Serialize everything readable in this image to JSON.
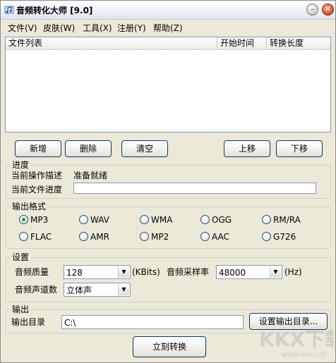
{
  "window": {
    "title": "音频转化大师 [9.0]",
    "minimize_glyph": "–",
    "maximize_glyph": "□",
    "close_glyph": "✕"
  },
  "menu": [
    "文件(V)",
    "皮肤(W)",
    "工具(X)",
    "注册(Y)",
    "帮助(Z)"
  ],
  "file_list": {
    "columns": [
      "文件列表",
      "开始时间",
      "转换长度"
    ],
    "rows": []
  },
  "list_buttons": {
    "add": "新增",
    "delete": "删除",
    "clear": "清空",
    "move_up": "上移",
    "move_down": "下移"
  },
  "progress": {
    "group_title": "进度",
    "operation_label": "当前操作描述",
    "operation_value": "准备就绪",
    "file_progress_label": "当前文件进度",
    "file_progress_value": 0
  },
  "output_format": {
    "group_title": "输出格式",
    "options": [
      "MP3",
      "WAV",
      "WMA",
      "OGG",
      "RM/RA",
      "FLAC",
      "AMR",
      "MP2",
      "AAC",
      "G726"
    ],
    "selected": "MP3"
  },
  "settings": {
    "group_title": "设置",
    "quality_label": "音频质量",
    "quality_value": "128",
    "quality_unit": "(KBits)",
    "sample_rate_label": "音频采样率",
    "sample_rate_value": "48000",
    "sample_rate_unit": "(Hz)",
    "channels_label": "音频声道数",
    "channels_value": "立体声"
  },
  "output": {
    "group_title": "输出",
    "dir_label": "输出目录",
    "dir_value": "C:\\",
    "set_dir_button": "设置输出目录..."
  },
  "convert_button": "立刻转换",
  "watermark": {
    "text": "KKX下载",
    "url": "www.kkx.net"
  },
  "colors": {
    "window_bg": "#ece9d8",
    "border_blue": "#7f9db9",
    "radio_dot": "#21a121",
    "close_red": "#e05030",
    "watermark": "#c4c4c4"
  }
}
